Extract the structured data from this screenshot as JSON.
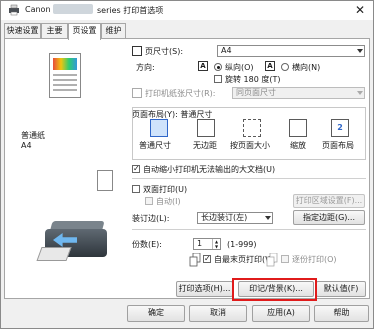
{
  "window": {
    "title_prefix": "Canon",
    "title_suffix": "series 打印首选项",
    "close_glyph": "✕"
  },
  "tabs": [
    {
      "label": "快速设置"
    },
    {
      "label": "主要"
    },
    {
      "label": "页设置"
    },
    {
      "label": "维护"
    }
  ],
  "preview": {
    "media_name": "普通纸",
    "media_size": "A4"
  },
  "page_size": {
    "label": "页尺寸(S):",
    "value": "A4"
  },
  "orientation": {
    "label": "方向:",
    "portrait": "纵向(O)",
    "landscape": "横向(N)",
    "rotate": "旋转 180 度(T)"
  },
  "printer_paper": {
    "label": "打印机纸张尺寸(R):",
    "value": "同页面尺寸"
  },
  "layout": {
    "label": "页面布局(Y):  普通尺寸",
    "options": [
      "普通尺寸",
      "无边距",
      "按页面大小",
      "缩放",
      "页面布局"
    ]
  },
  "auto_reduce": {
    "label": "自动缩小打印机无法输出的大文档(U)"
  },
  "duplex": {
    "label": "双面打印(U)",
    "auto": "自动(I)",
    "print_area_button": "打印区域设置(F)..."
  },
  "stapling": {
    "label": "装订边(L):",
    "value": "长边装订(左)",
    "margin_button": "指定边距(G)..."
  },
  "copies": {
    "label": "份数(E):",
    "value": "1",
    "range": "(1-999)",
    "collate": "自最末页打印(W)",
    "reverse": "逐份打印(O)"
  },
  "actions": {
    "print_options": "打印选项(H)...",
    "stamp_background": "印记/背景(K)...",
    "defaults": "默认值(F)"
  },
  "footer": {
    "ok": "确定",
    "cancel": "取消",
    "apply": "应用(A)",
    "help": "帮助"
  }
}
